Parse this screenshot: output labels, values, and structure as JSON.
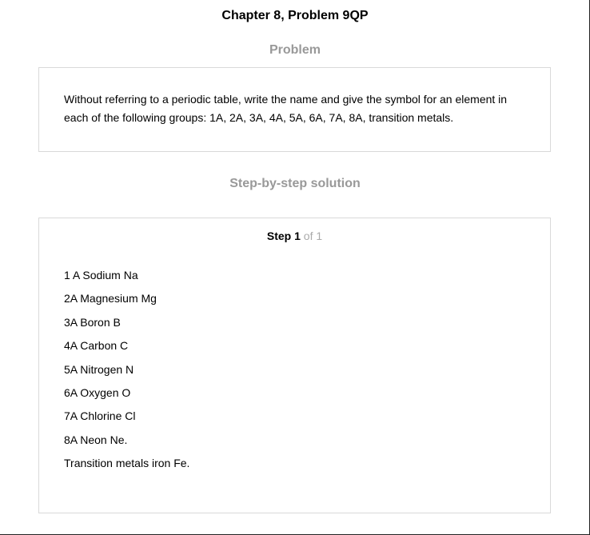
{
  "header": {
    "title": "Chapter 8, Problem 9QP"
  },
  "problem": {
    "heading": "Problem",
    "text": "Without referring to a periodic table, write the name and give the symbol for an element in each of the following groups: 1A, 2A, 3A, 4A, 5A, 6A, 7A, 8A, transition metals."
  },
  "solution": {
    "heading": "Step-by-step solution",
    "step_word": "Step",
    "step_number": "1",
    "step_of": "of 1",
    "lines": [
      "1 A Sodium Na",
      "2A Magnesium Mg",
      "3A Boron B",
      "4A Carbon C",
      "5A Nitrogen N",
      "6A Oxygen O",
      "7A Chlorine Cl",
      "8A Neon Ne.",
      "Transition metals iron Fe."
    ]
  }
}
